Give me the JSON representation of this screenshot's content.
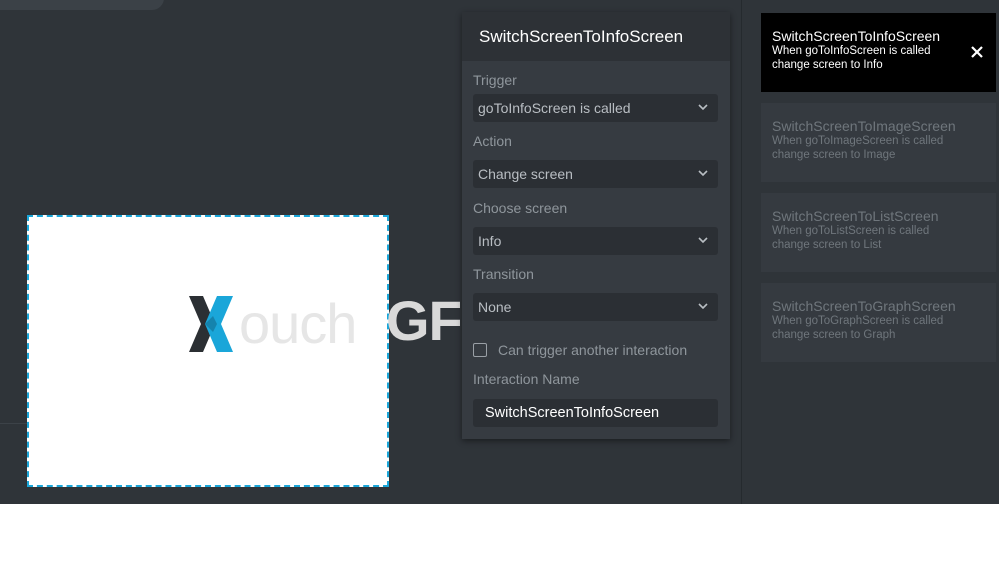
{
  "editor": {
    "title": "SwitchScreenToInfoScreen",
    "trigger_label": "Trigger",
    "trigger_value": "goToInfoScreen is called",
    "action_label": "Action",
    "action_value": "Change screen",
    "choose_screen_label": "Choose screen",
    "choose_screen_value": "Info",
    "transition_label": "Transition",
    "transition_value": "None",
    "can_trigger_label": "Can trigger another interaction",
    "can_trigger_checked": false,
    "interaction_name_label": "Interaction Name",
    "interaction_name_value": "SwitchScreenToInfoScreen"
  },
  "preview": {
    "logo_text_light": "ouch",
    "logo_text_bold": "GF"
  },
  "interactions": [
    {
      "title": "SwitchScreenToInfoScreen",
      "desc_line1": "When goToInfoScreen is called",
      "desc_line2": "change screen to Info",
      "active": true
    },
    {
      "title": "SwitchScreenToImageScreen",
      "desc_line1": "When goToImageScreen is called",
      "desc_line2": "change screen to Image",
      "active": false
    },
    {
      "title": "SwitchScreenToListScreen",
      "desc_line1": "When goToListScreen is called",
      "desc_line2": "change screen to List",
      "active": false
    },
    {
      "title": "SwitchScreenToGraphScreen",
      "desc_line1": "When goToGraphScreen is called",
      "desc_line2": "change screen to Graph",
      "active": false
    }
  ],
  "colors": {
    "background": "#2f3439",
    "panel": "#363b41",
    "accent": "#1aa6d9",
    "active_card": "#000000"
  },
  "icons": {
    "dropdown": "chevron-down-icon",
    "close": "close-icon",
    "logo": "touchgfx-logo-icon"
  }
}
